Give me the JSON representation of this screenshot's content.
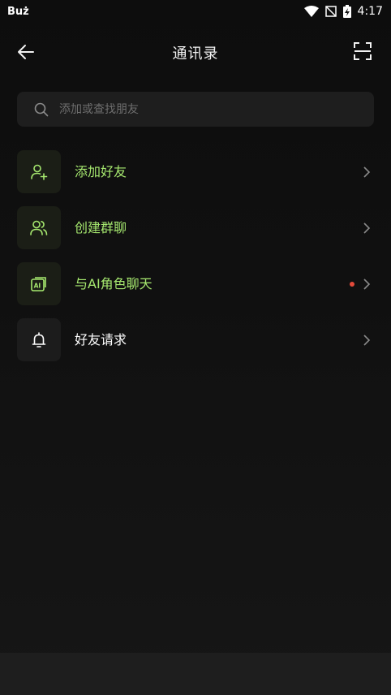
{
  "status_bar": {
    "app_label": "Buż",
    "time": "4:17"
  },
  "header": {
    "title": "通讯录",
    "back_icon": "arrow-left-icon",
    "scan_icon": "scan-frame-icon"
  },
  "search": {
    "placeholder": "添加或查找朋友",
    "value": ""
  },
  "menu": [
    {
      "label": "添加好友",
      "icon": "add-user-icon",
      "color": "#a6e86f",
      "badge": false
    },
    {
      "label": "创建群聊",
      "icon": "group-icon",
      "color": "#a6e86f",
      "badge": false
    },
    {
      "label": "与AI角色聊天",
      "icon": "ai-chat-icon",
      "color": "#a6e86f",
      "badge": true
    },
    {
      "label": "好友请求",
      "icon": "bell-icon",
      "color": "#ffffff",
      "badge": false
    }
  ],
  "colors": {
    "accent": "#a6e86f",
    "badge": "#e44a3a",
    "background": "#121212"
  }
}
